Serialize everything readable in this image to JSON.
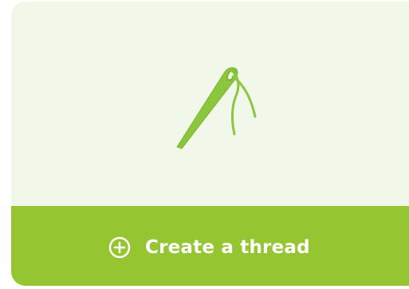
{
  "card": {
    "background": "#f1f8e9",
    "accent": "#95c531",
    "illustration_icon": "needle-and-thread-icon",
    "action": {
      "icon": "plus-circle-icon",
      "label": "Create a thread"
    }
  }
}
